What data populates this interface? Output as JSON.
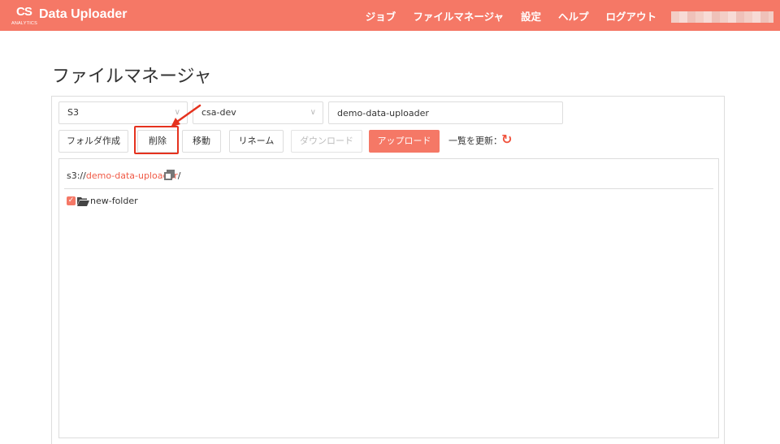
{
  "brand": {
    "logo": "CS",
    "sub": "ANALYTICS",
    "title": "Data Uploader"
  },
  "nav": {
    "items": [
      "ジョブ",
      "ファイルマネージャ",
      "設定",
      "ヘルプ",
      "ログアウト"
    ]
  },
  "page": {
    "title": "ファイルマネージャ"
  },
  "selectors": {
    "storage": "S3",
    "bucket": "csa-dev",
    "path": "demo-data-uploader"
  },
  "toolbar": {
    "create_folder": "フォルダ作成",
    "delete": "削除",
    "move": "移動",
    "rename": "リネーム",
    "download": "ダウンロード",
    "upload": "アップロード",
    "refresh_label": "一覧を更新："
  },
  "browser": {
    "crumb_prefix": "s3://",
    "crumb_link": "demo-data-uploader",
    "crumb_suffix": "/",
    "items": [
      {
        "name": "new-folder",
        "checked": true
      }
    ]
  },
  "colors": {
    "accent": "#f57866",
    "highlight": "#e5321e",
    "link": "#f05a46"
  }
}
